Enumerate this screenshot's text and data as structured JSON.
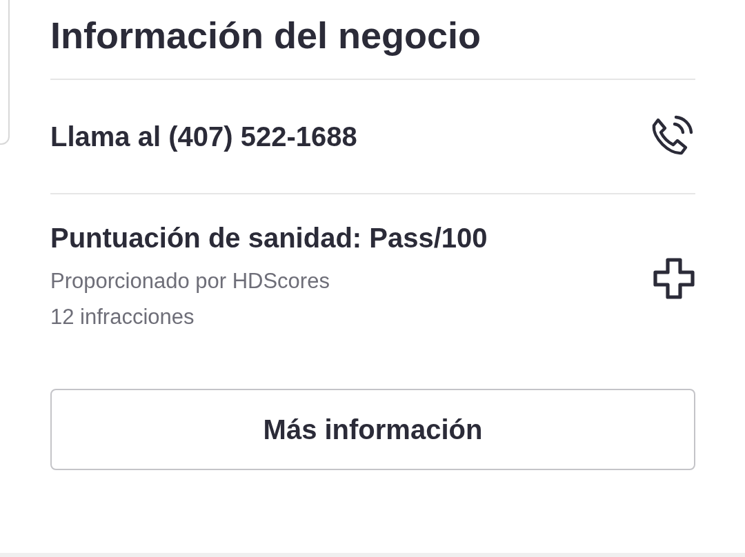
{
  "section": {
    "title": "Información del negocio"
  },
  "rows": [
    {
      "kind": "phone",
      "title": "Llama al (407) 522-1688"
    },
    {
      "kind": "health",
      "title": "Puntuación de sanidad: Pass/100",
      "lines": [
        "Proporcionado por HDScores",
        "12 infracciones"
      ]
    }
  ],
  "button": {
    "label": "Más información"
  }
}
